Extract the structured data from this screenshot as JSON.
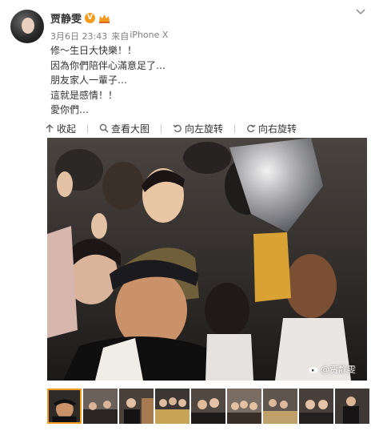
{
  "post": {
    "author_name": "贾静雯",
    "time": "3月6日 23:43",
    "source_prefix": "来自",
    "device": "iPhone X",
    "text": "修～生日大快樂！！\n因為你們陪伴心滿意足了…\n朋友家人一輩子…\n這就是感情！！\n愛你們…"
  },
  "toolbar": {
    "collapse": "收起",
    "view_large": "查看大图",
    "rotate_left": "向左旋转",
    "rotate_right": "向右旋转"
  },
  "photo": {
    "watermark": "@贾静雯"
  },
  "icons": {
    "verified": "verified-v-icon",
    "crown": "vip-crown-icon",
    "menu": "chevron-down-icon",
    "collapse": "arrow-up-icon",
    "view_large": "magnifier-icon",
    "rotate_left": "rotate-left-icon",
    "rotate_right": "rotate-right-icon",
    "watermark": "weibo-logo-icon"
  },
  "thumbnails": [
    {
      "selected": true
    },
    {
      "selected": false
    },
    {
      "selected": false
    },
    {
      "selected": false
    },
    {
      "selected": false
    },
    {
      "selected": false
    },
    {
      "selected": false
    },
    {
      "selected": false
    },
    {
      "selected": false
    }
  ],
  "colors": {
    "accent": "#f29b1f",
    "text": "#333333",
    "meta": "#808080"
  }
}
